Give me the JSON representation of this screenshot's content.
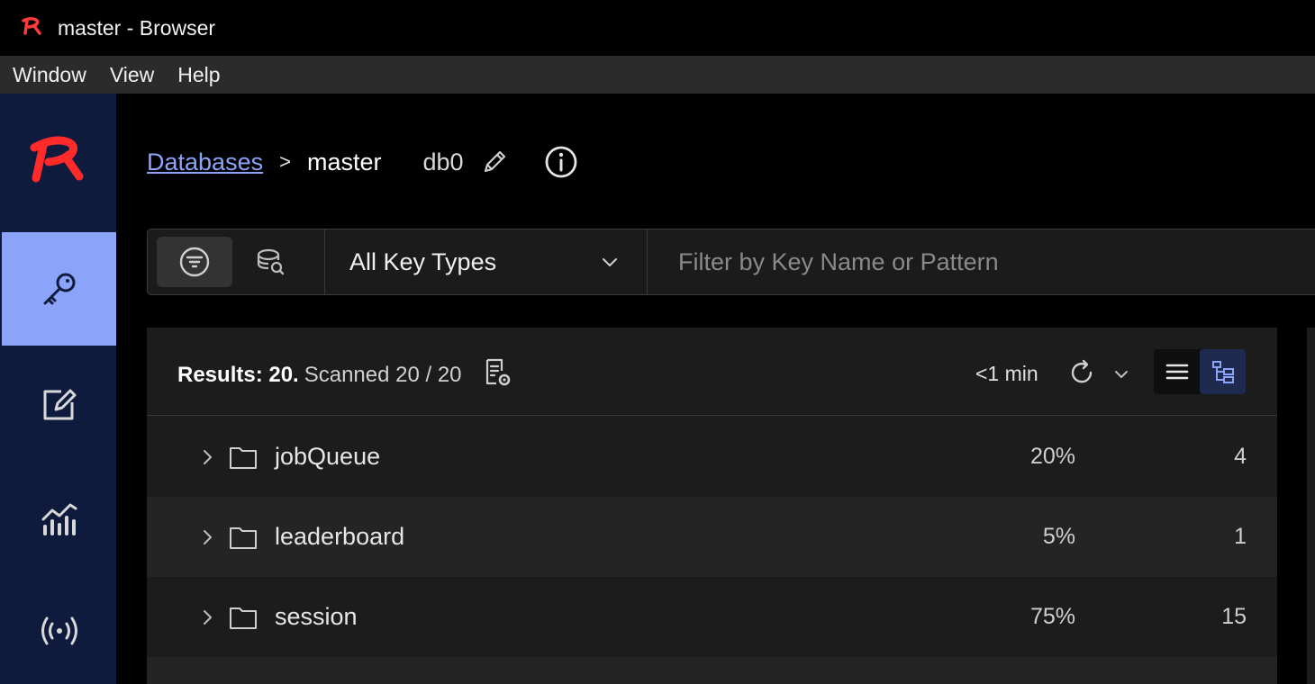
{
  "window": {
    "title": "master - Browser"
  },
  "menu": {
    "items": [
      "Window",
      "View",
      "Help"
    ]
  },
  "sidebar": {
    "items": [
      {
        "name": "browser",
        "icon": "key-icon",
        "active": true
      },
      {
        "name": "workbench",
        "icon": "edit-icon",
        "active": false
      },
      {
        "name": "analytics",
        "icon": "analytics-icon",
        "active": false
      },
      {
        "name": "pubsub",
        "icon": "broadcast-icon",
        "active": false
      }
    ]
  },
  "breadcrumb": {
    "databases": "Databases",
    "separator": ">",
    "current": "master",
    "db": "db0"
  },
  "filter": {
    "key_type": "All Key Types",
    "search_placeholder": "Filter by Key Name or Pattern"
  },
  "results": {
    "label": "Results: 20.",
    "scanned": "Scanned 20 / 20",
    "refresh_time": "<1 min",
    "rows": [
      {
        "name": "jobQueue",
        "percent": "20%",
        "count": "4"
      },
      {
        "name": "leaderboard",
        "percent": "5%",
        "count": "1"
      },
      {
        "name": "session",
        "percent": "75%",
        "count": "15"
      }
    ]
  },
  "colors": {
    "accent": "#8ba4f9",
    "sidebar_bg": "#0f1b3d",
    "logo_red": "#ff2a2a"
  }
}
